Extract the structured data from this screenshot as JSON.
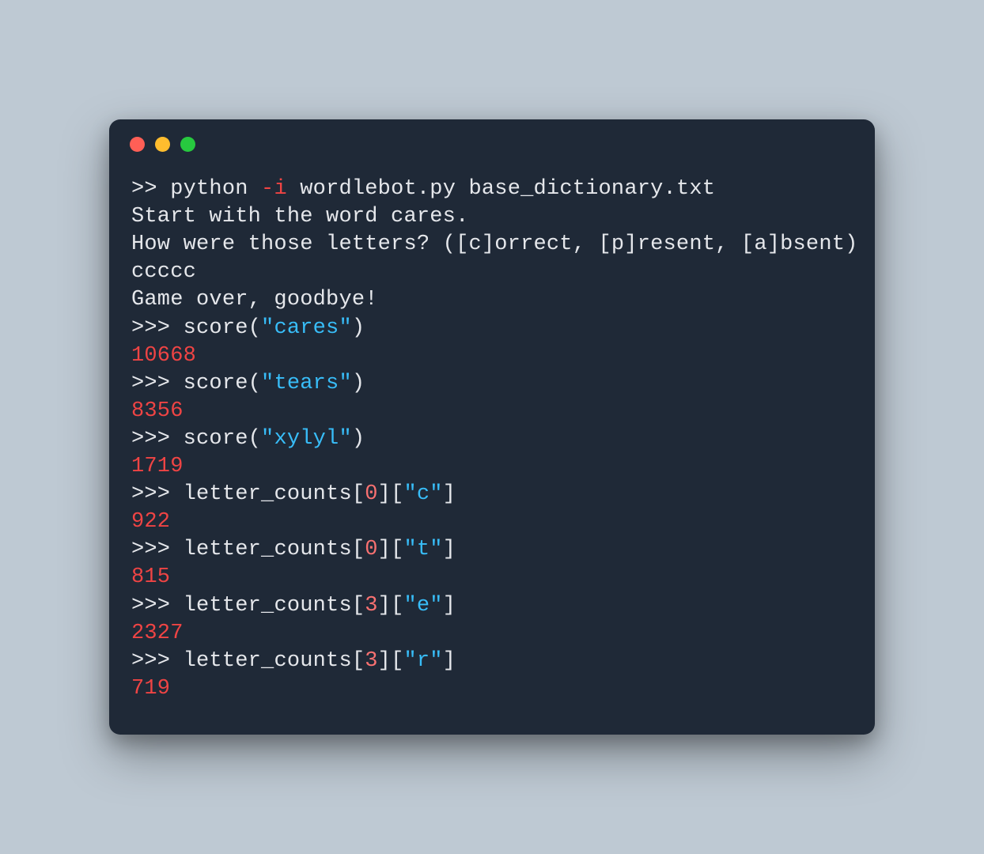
{
  "colors": {
    "background": "#bec9d3",
    "terminal_bg": "#1f2937",
    "text": "#e5e7eb",
    "red": "#ef4444",
    "string": "#38bdf8",
    "traffic_close": "#ff5f56",
    "traffic_min": "#ffbd2e",
    "traffic_max": "#27c93f"
  },
  "shell_prompt": ">> ",
  "repl_prompt": ">>> ",
  "command": {
    "interpreter": "python",
    "flag": "-i",
    "args": " wordlebot.py base_dictionary.txt"
  },
  "output_lines": {
    "l1": "Start with the word cares.",
    "l2": "How were those letters? ([c]orrect, [p]resent, [a]bsent)",
    "l3": "ccccc",
    "l4": "Game over, goodbye!"
  },
  "repl": [
    {
      "call_prefix": "score(",
      "arg": "\"cares\"",
      "call_suffix": ")",
      "result": "10668"
    },
    {
      "call_prefix": "score(",
      "arg": "\"tears\"",
      "call_suffix": ")",
      "result": "8356"
    },
    {
      "call_prefix": "score(",
      "arg": "\"xylyl\"",
      "call_suffix": ")",
      "result": "1719"
    },
    {
      "call_prefix": "letter_counts[",
      "idx": "0",
      "mid": "][",
      "arg": "\"c\"",
      "call_suffix": "]",
      "result": "922"
    },
    {
      "call_prefix": "letter_counts[",
      "idx": "0",
      "mid": "][",
      "arg": "\"t\"",
      "call_suffix": "]",
      "result": "815"
    },
    {
      "call_prefix": "letter_counts[",
      "idx": "3",
      "mid": "][",
      "arg": "\"e\"",
      "call_suffix": "]",
      "result": "2327"
    },
    {
      "call_prefix": "letter_counts[",
      "idx": "3",
      "mid": "][",
      "arg": "\"r\"",
      "call_suffix": "]",
      "result": "719"
    }
  ]
}
